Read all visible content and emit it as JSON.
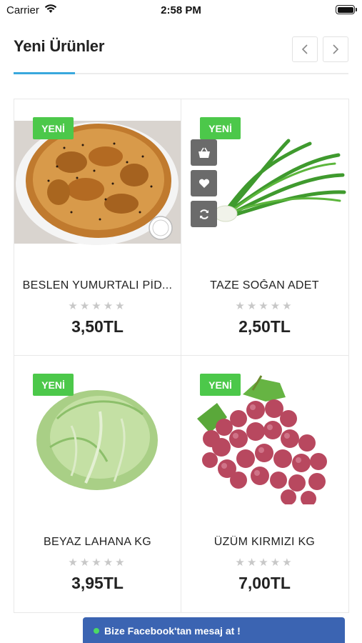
{
  "status_bar": {
    "carrier": "Carrier",
    "time": "2:58 PM"
  },
  "section": {
    "title": "Yeni Ürünler",
    "prev_icon": "chevron-left-icon",
    "next_icon": "chevron-right-icon",
    "accent_color": "#39a8dd"
  },
  "products": [
    {
      "badge": "YENİ",
      "name": "BESLEN YUMURTALI PİD...",
      "rating": 0,
      "rating_max": 5,
      "price": "3,50TL",
      "image": "pide-bread"
    },
    {
      "badge": "YENİ",
      "name": "TAZE SOĞAN ADET",
      "rating": 0,
      "rating_max": 5,
      "price": "2,50TL",
      "image": "green-onions"
    },
    {
      "badge": "YENİ",
      "name": "BEYAZ LAHANA KG",
      "rating": 0,
      "rating_max": 5,
      "price": "3,95TL",
      "image": "white-cabbage"
    },
    {
      "badge": "YENİ",
      "name": "ÜZÜM KIRMIZI KG",
      "rating": 0,
      "rating_max": 5,
      "price": "7,00TL",
      "image": "red-grapes"
    }
  ],
  "hover_actions": [
    "basket-icon",
    "heart-icon",
    "refresh-icon"
  ],
  "badge_color": "#4cc84a",
  "facebook": {
    "label": "Bize Facebook'tan mesaj at !",
    "color": "#3b64b2"
  }
}
